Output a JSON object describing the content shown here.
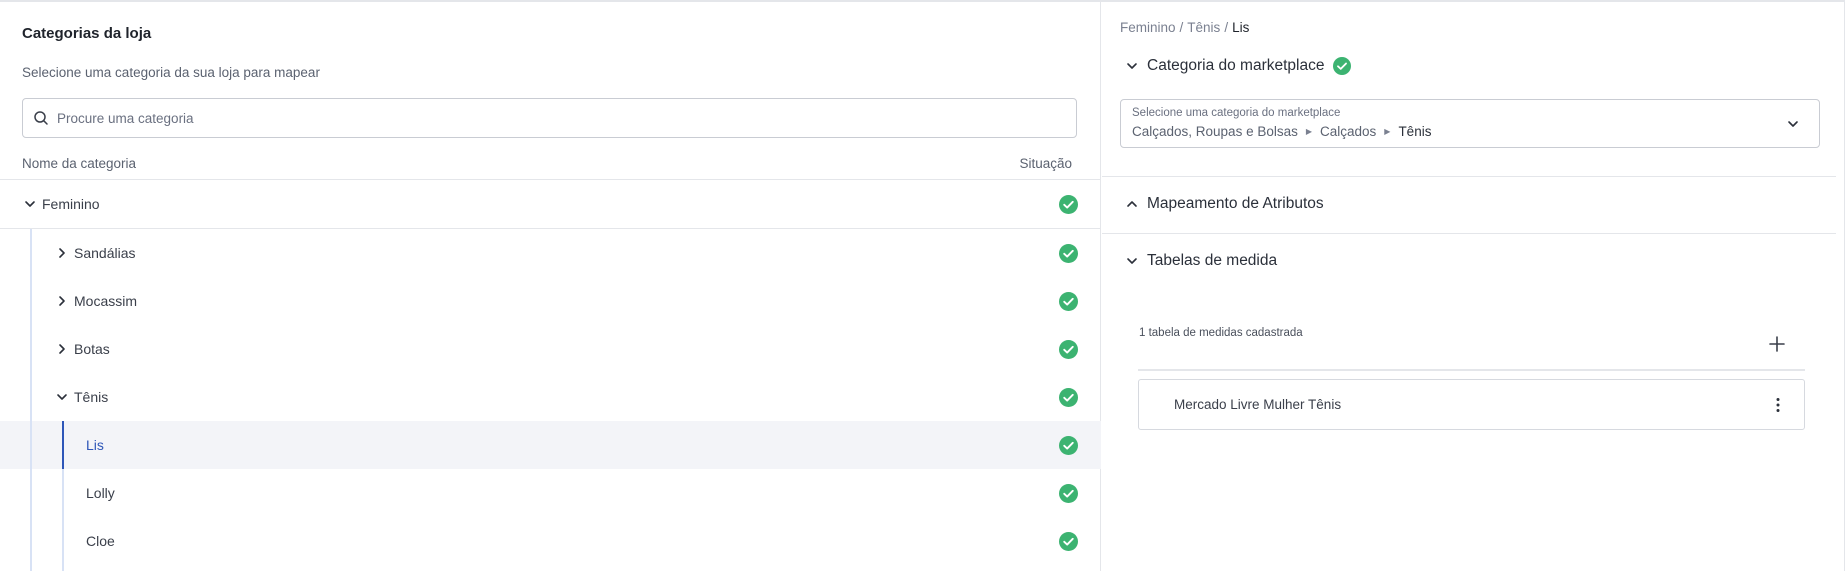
{
  "left": {
    "title": "Categorias da loja",
    "subtitle": "Selecione uma categoria da sua loja para mapear",
    "search": {
      "placeholder": "Procure uma categoria",
      "value": ""
    },
    "columns": {
      "name": "Nome da categoria",
      "status": "Situação"
    },
    "tree": [
      {
        "label": "Feminino",
        "expanded": true,
        "status": "mapped"
      },
      {
        "label": "Sandálias",
        "expanded": false,
        "status": "mapped"
      },
      {
        "label": "Mocassim",
        "expanded": false,
        "status": "mapped"
      },
      {
        "label": "Botas",
        "expanded": false,
        "status": "mapped"
      },
      {
        "label": "Tênis",
        "expanded": true,
        "status": "mapped"
      },
      {
        "label": "Lis",
        "selected": true,
        "status": "mapped"
      },
      {
        "label": "Lolly",
        "status": "mapped"
      },
      {
        "label": "Cloe",
        "status": "mapped"
      }
    ]
  },
  "right": {
    "breadcrumb": [
      "Feminino",
      "Tênis",
      "Lis"
    ],
    "marketplace_section": {
      "title": "Categoria do marketplace",
      "select_label": "Selecione uma categoria do marketplace",
      "path": [
        "Calçados, Roupas e Bolsas",
        "Calçados",
        "Tênis"
      ]
    },
    "attributes_section": {
      "title": "Mapeamento de Atributos"
    },
    "size_tables_section": {
      "title": "Tabelas de medida",
      "count_text": "1 tabela de medidas cadastrada",
      "tables": [
        {
          "name": "Mercado Livre Mulher Tênis"
        }
      ]
    }
  },
  "colors": {
    "accent": "#2e56b8",
    "success": "#3cb371",
    "border": "#e4e6ea",
    "selected_row": "#f3f4f8"
  },
  "icons": {
    "search": "search-icon",
    "expand": "chevron-down-icon",
    "collapse": "chevron-right-icon",
    "status": "check-circle-icon",
    "add": "plus-icon",
    "more": "kebab-menu-icon"
  }
}
